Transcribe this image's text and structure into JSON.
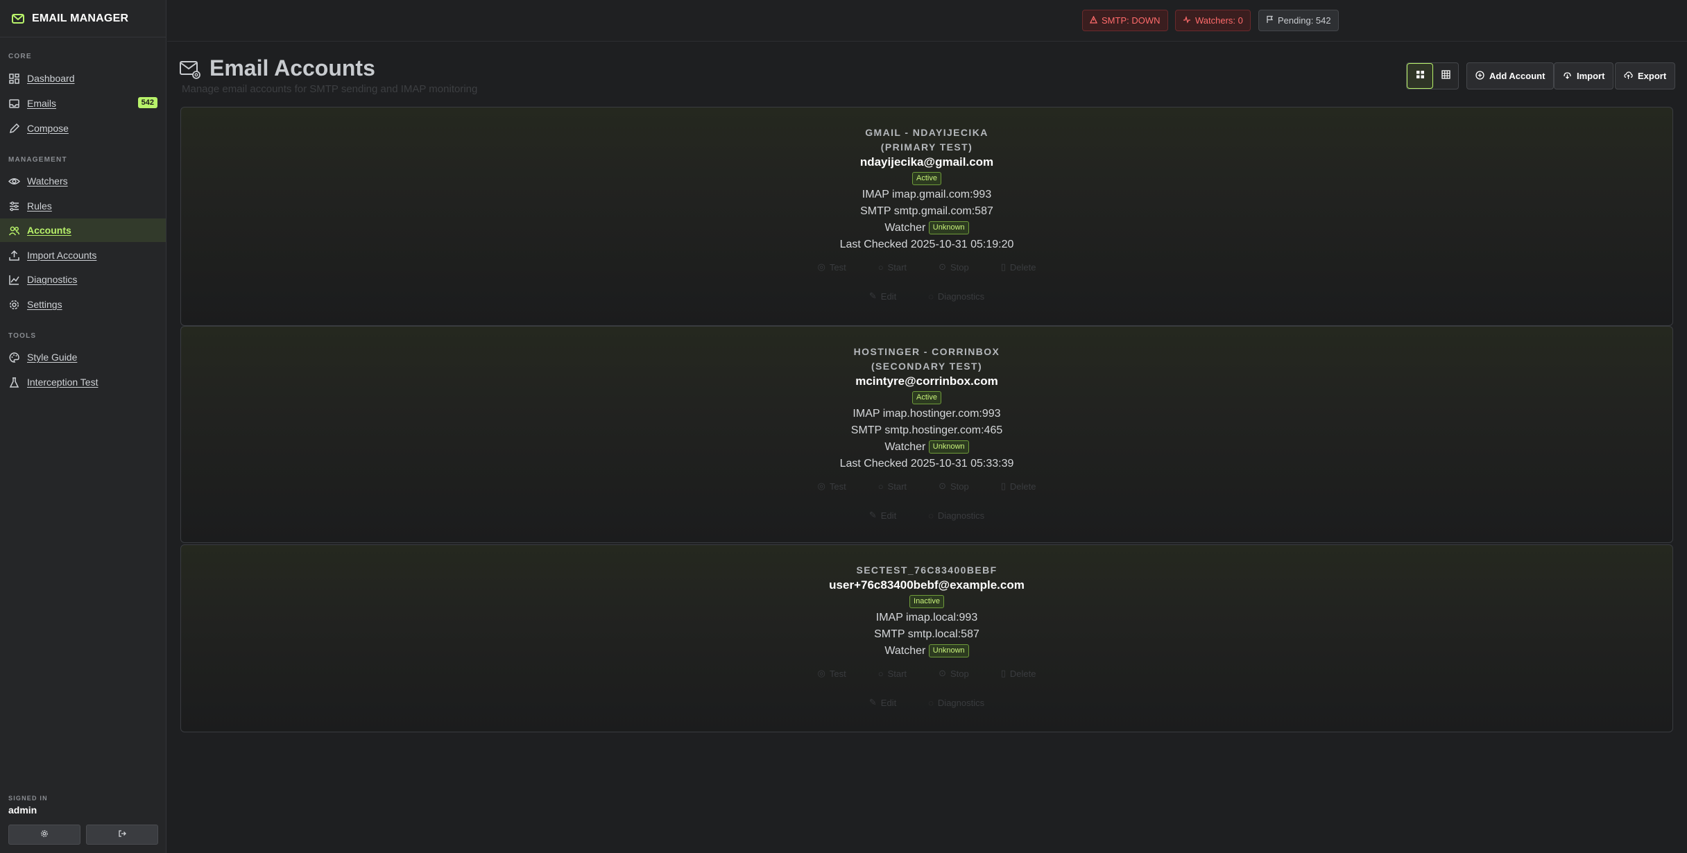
{
  "brand": {
    "title": "EMAIL MANAGER"
  },
  "sidebar": {
    "sections": [
      {
        "label": "CORE"
      },
      {
        "label": "MANAGEMENT"
      },
      {
        "label": "TOOLS"
      }
    ],
    "items": [
      {
        "label": "Dashboard",
        "icon": "dashboard-icon"
      },
      {
        "label": "Emails",
        "icon": "inbox-icon",
        "badge": "542"
      },
      {
        "label": "Compose",
        "icon": "pencil-icon"
      },
      {
        "label": "Watchers",
        "icon": "eye-icon"
      },
      {
        "label": "Rules",
        "icon": "sliders-icon"
      },
      {
        "label": "Accounts",
        "icon": "users-icon",
        "active": true
      },
      {
        "label": "Import Accounts",
        "icon": "upload-icon"
      },
      {
        "label": "Diagnostics",
        "icon": "chart-icon"
      },
      {
        "label": "Settings",
        "icon": "gear-icon"
      },
      {
        "label": "Style Guide",
        "icon": "palette-icon"
      },
      {
        "label": "Interception Test",
        "icon": "flask-icon"
      }
    ],
    "signed_in_label": "SIGNED IN",
    "user": "admin"
  },
  "status": {
    "smtp": "SMTP: DOWN",
    "watchers": "Watchers: 0",
    "pending": "Pending: 542"
  },
  "page": {
    "title": "Email Accounts",
    "subtitle": "Manage email accounts for SMTP sending and IMAP monitoring",
    "add_label": "Add Account",
    "import_label": "Import",
    "export_label": "Export"
  },
  "actions": {
    "test": "Test",
    "start": "Start",
    "stop": "Stop",
    "delete": "Delete",
    "edit": "Edit",
    "diagnostics": "Diagnostics"
  },
  "accounts": [
    {
      "name_line1": "GMAIL - NDAYIJECIKA",
      "name_line2": "(PRIMARY TEST)",
      "email": "ndayijecika@gmail.com",
      "status": "Active",
      "imap": "IMAP imap.gmail.com:993",
      "smtp": "SMTP smtp.gmail.com:587",
      "watcher_label": "Watcher",
      "watcher_status": "Unknown",
      "last_checked": "Last Checked 2025-10-31 05:19:20"
    },
    {
      "name_line1": "HOSTINGER - CORRINBOX",
      "name_line2": "(SECONDARY TEST)",
      "email": "mcintyre@corrinbox.com",
      "status": "Active",
      "imap": "IMAP imap.hostinger.com:993",
      "smtp": "SMTP smtp.hostinger.com:465",
      "watcher_label": "Watcher",
      "watcher_status": "Unknown",
      "last_checked": "Last Checked 2025-10-31 05:33:39"
    },
    {
      "name_line1": "SECTEST_76C83400BEBF",
      "email": "user+76c83400bebf@example.com",
      "status": "Inactive",
      "imap": "IMAP imap.local:993",
      "smtp": "SMTP smtp.local:587",
      "watcher_label": "Watcher",
      "watcher_status": "Unknown"
    }
  ],
  "colors": {
    "accent": "#b8f26a",
    "error": "#ff6b6b",
    "background": "#1e1f21",
    "sidebar": "#252628"
  }
}
